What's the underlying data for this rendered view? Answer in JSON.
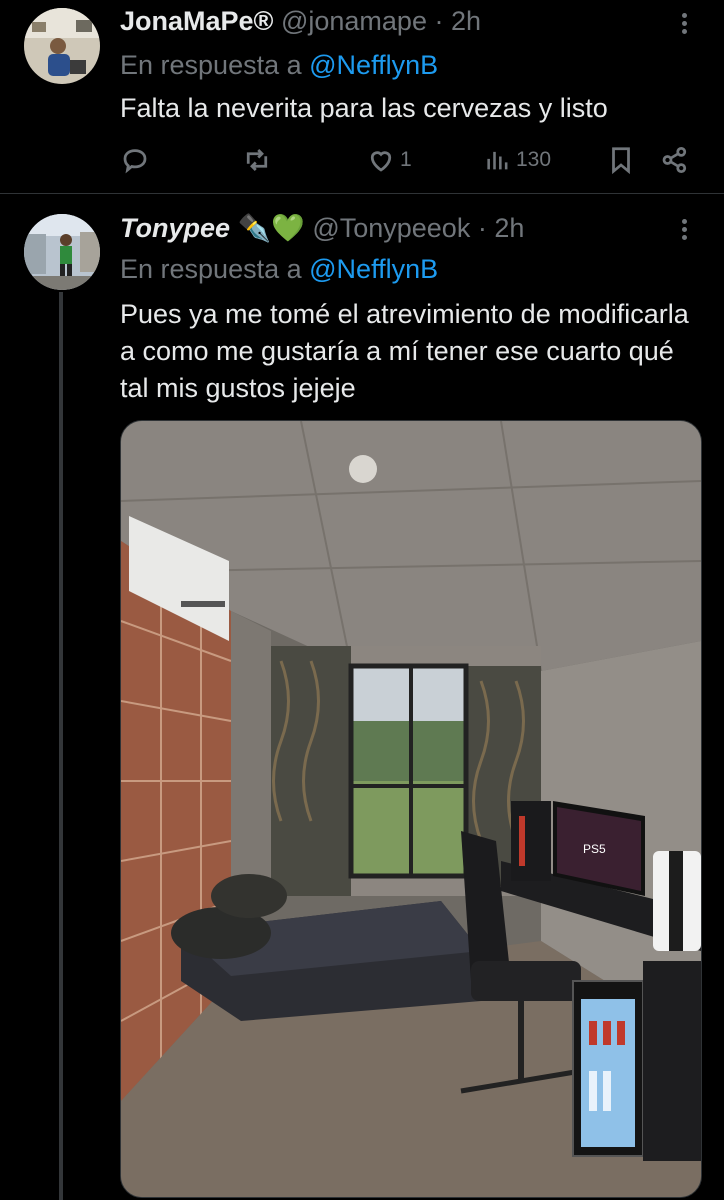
{
  "tweet1": {
    "name": "JonaMaPe®",
    "handle": "@jonamape",
    "separator": "·",
    "time": "2h",
    "reply_prefix": "En respuesta a",
    "reply_to": "@NefflynB",
    "text": "Falta la neverita para las cervezas y listo",
    "likes": "1",
    "views": "130"
  },
  "tweet2": {
    "name": "Tonypee",
    "name_emojis": "✒️💚",
    "handle": "@Tonypeeok",
    "separator": "·",
    "time": "2h",
    "reply_prefix": "En respuesta a",
    "reply_to": "@NefflynB",
    "text": "Pues ya me tomé el atrevimiento de modificarla a como me gustaría a mí tener ese cuarto qué tal mis gustos jejeje",
    "media_label": "PS5"
  },
  "icons": [
    "more-icon",
    "reply-icon",
    "retweet-icon",
    "like-icon",
    "views-icon",
    "bookmark-icon",
    "share-icon"
  ],
  "colors": {
    "background": "#000000",
    "text": "#e7e9ea",
    "muted": "#71767b",
    "link": "#1d9bf0",
    "divider": "#2f3336"
  }
}
